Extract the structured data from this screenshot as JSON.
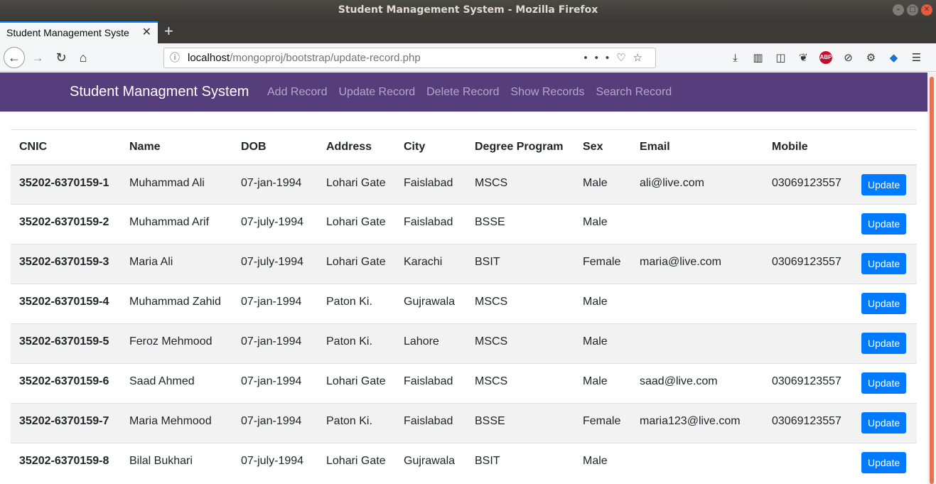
{
  "window": {
    "title": "Student Management System - Mozilla Firefox"
  },
  "browser": {
    "tab_title": "Student Management Syste",
    "url_host": "localhost",
    "url_path": "/mongoproj/bootstrap/update-record.php"
  },
  "site": {
    "brand": "Student Managment System",
    "nav": [
      "Add Record",
      "Update Record",
      "Delete Record",
      "Show Records",
      "Search Record"
    ]
  },
  "table": {
    "headers": [
      "CNIC",
      "Name",
      "DOB",
      "Address",
      "City",
      "Degree Program",
      "Sex",
      "Email",
      "Mobile"
    ],
    "button_label": "Update",
    "rows": [
      {
        "cnic": "35202-6370159-1",
        "name": "Muhammad Ali",
        "dob": "07-jan-1994",
        "address": "Lohari Gate",
        "city": "Faislabad",
        "degree": "MSCS",
        "sex": "Male",
        "email": "ali@live.com",
        "mobile": "03069123557"
      },
      {
        "cnic": "35202-6370159-2",
        "name": "Muhammad Arif",
        "dob": "07-july-1994",
        "address": "Lohari Gate",
        "city": "Faislabad",
        "degree": "BSSE",
        "sex": "Male",
        "email": "",
        "mobile": ""
      },
      {
        "cnic": "35202-6370159-3",
        "name": "Maria Ali",
        "dob": "07-july-1994",
        "address": "Lohari Gate",
        "city": "Karachi",
        "degree": "BSIT",
        "sex": "Female",
        "email": "maria@live.com",
        "mobile": "03069123557"
      },
      {
        "cnic": "35202-6370159-4",
        "name": "Muhammad Zahid",
        "dob": "07-jan-1994",
        "address": "Paton Ki.",
        "city": "Gujrawala",
        "degree": "MSCS",
        "sex": "Male",
        "email": "",
        "mobile": ""
      },
      {
        "cnic": "35202-6370159-5",
        "name": "Feroz Mehmood",
        "dob": "07-jan-1994",
        "address": "Paton Ki.",
        "city": "Lahore",
        "degree": "MSCS",
        "sex": "Male",
        "email": "",
        "mobile": ""
      },
      {
        "cnic": "35202-6370159-6",
        "name": "Saad Ahmed",
        "dob": "07-jan-1994",
        "address": "Lohari Gate",
        "city": "Faislabad",
        "degree": "MSCS",
        "sex": "Male",
        "email": "saad@live.com",
        "mobile": "03069123557"
      },
      {
        "cnic": "35202-6370159-7",
        "name": "Maria Mehmood",
        "dob": "07-jan-1994",
        "address": "Paton Ki.",
        "city": "Faislabad",
        "degree": "BSSE",
        "sex": "Female",
        "email": "maria123@live.com",
        "mobile": "03069123557"
      },
      {
        "cnic": "35202-6370159-8",
        "name": "Bilal Bukhari",
        "dob": "07-july-1994",
        "address": "Lohari Gate",
        "city": "Gujrawala",
        "degree": "BSIT",
        "sex": "Male",
        "email": "",
        "mobile": ""
      }
    ]
  },
  "colors": {
    "navbar": "#563d7c",
    "button": "#007bff",
    "stripe": "#f2f2f2"
  }
}
